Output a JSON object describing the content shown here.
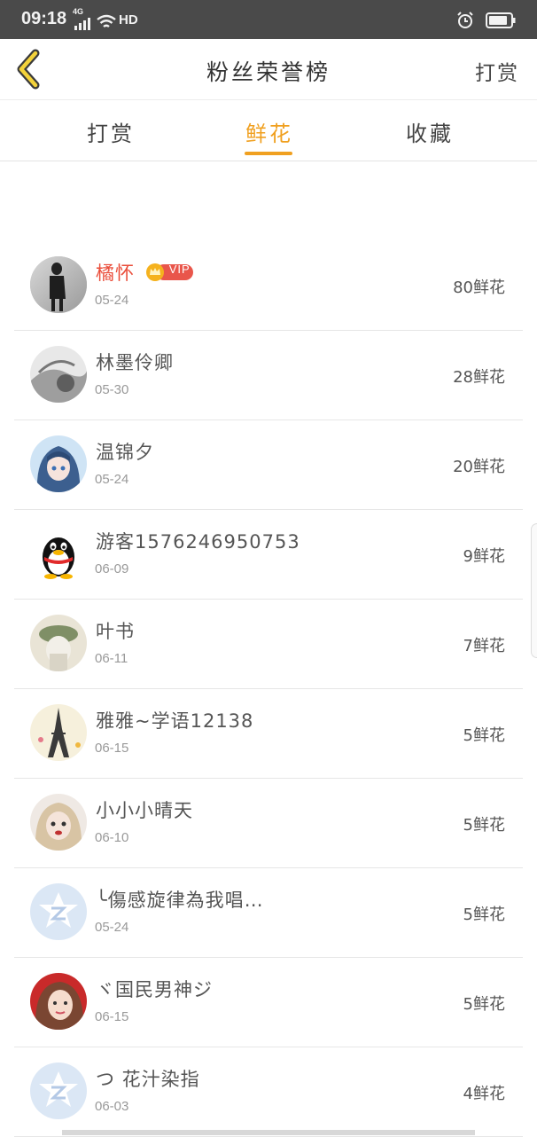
{
  "status_bar": {
    "time": "09:18",
    "network": "4G",
    "hd": "HD"
  },
  "nav": {
    "title": "粉丝荣誉榜",
    "right_action": "打赏"
  },
  "tabs": [
    {
      "label": "打赏",
      "active": false
    },
    {
      "label": "鲜花",
      "active": true
    },
    {
      "label": "收藏",
      "active": false
    }
  ],
  "vip_label": "VIP",
  "colors": {
    "accent": "#f0a020",
    "vip_name": "#ea4d3a",
    "vip_badge": "#e9564b",
    "crown": "#f5b21e"
  },
  "fans": [
    {
      "name": "橘怀",
      "date": "05-24",
      "amount": "80鲜花",
      "vip": true,
      "avatar": "avatar-photo-dark"
    },
    {
      "name": "林墨伶卿",
      "date": "05-30",
      "amount": "28鲜花",
      "vip": false,
      "avatar": "avatar-photo-gray"
    },
    {
      "name": "温锦夕",
      "date": "05-24",
      "amount": "20鲜花",
      "vip": false,
      "avatar": "avatar-anime-girl"
    },
    {
      "name": "游客1576246950753",
      "date": "06-09",
      "amount": "9鲜花",
      "vip": false,
      "avatar": "avatar-penguin"
    },
    {
      "name": "叶书",
      "date": "06-11",
      "amount": "7鲜花",
      "vip": false,
      "avatar": "avatar-photo-hat"
    },
    {
      "name": "雅雅~学语12138",
      "date": "06-15",
      "amount": "5鲜花",
      "vip": false,
      "avatar": "avatar-eiffel"
    },
    {
      "name": "小小小晴天",
      "date": "06-10",
      "amount": "5鲜花",
      "vip": false,
      "avatar": "avatar-doll"
    },
    {
      "name": "╰傷感旋律為我唱…",
      "date": "05-24",
      "amount": "5鲜花",
      "vip": false,
      "avatar": "avatar-default"
    },
    {
      "name": "ヾ国民男神ジ",
      "date": "06-15",
      "amount": "5鲜花",
      "vip": false,
      "avatar": "avatar-girl-photo"
    },
    {
      "name": "つ 花汁染指",
      "date": "06-03",
      "amount": "4鲜花",
      "vip": false,
      "avatar": "avatar-default"
    }
  ]
}
